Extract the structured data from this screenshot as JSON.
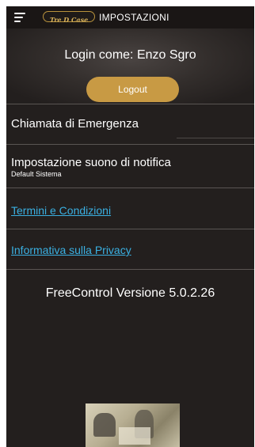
{
  "header": {
    "logo_text": "Tre D Case",
    "title": "IMPOSTAZIONI"
  },
  "account": {
    "login_text": "Login come: Enzo Sgro",
    "logout_label": "Logout"
  },
  "settings": {
    "emergency_call_label": "Chiamata di Emergenza",
    "notification_sound_label": "Impostazione suono di notifica",
    "notification_sound_value": "Default Sistema"
  },
  "links": {
    "terms_label": "Termini e Condizioni",
    "privacy_label": "Informativa sulla Privacy"
  },
  "footer": {
    "version_text": "FreeControl Versione 5.0.2.26"
  },
  "colors": {
    "background": "#231f1e",
    "accent_gold": "#c89a44",
    "link_blue": "#3ab0e2"
  },
  "icons": {
    "menu": "hamburger-menu-icon"
  }
}
